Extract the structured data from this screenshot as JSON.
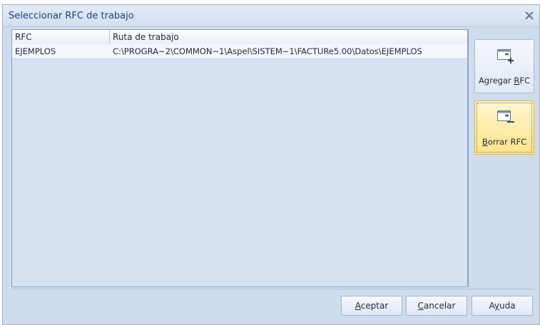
{
  "window": {
    "title": "Seleccionar RFC de trabajo"
  },
  "grid": {
    "columns": [
      "RFC",
      "Ruta de trabajo"
    ],
    "rows": [
      {
        "rfc": "EJEMPLOS",
        "ruta": "C:\\PROGRA~2\\COMMON~1\\Aspel\\SISTEM~1\\FACTURe5.00\\Datos\\EJEMPLOS"
      }
    ]
  },
  "side_buttons": {
    "add": {
      "mnemonic_before": "Agregar ",
      "mnemonic_char": "R",
      "mnemonic_after": "FC",
      "icon": "add-rfc-icon"
    },
    "delete": {
      "mnemonic_before": "",
      "mnemonic_char": "B",
      "mnemonic_after": "orrar RFC",
      "icon": "delete-rfc-icon"
    }
  },
  "footer": {
    "accept": {
      "char": "A",
      "rest": "ceptar"
    },
    "cancel": {
      "char": "C",
      "rest": "ancelar"
    },
    "help": {
      "before": "A",
      "char": "y",
      "rest": "uda"
    }
  },
  "colors": {
    "window_bg": "#cfdcee",
    "title_text": "#15428b",
    "active_button": "#ffe48a"
  }
}
